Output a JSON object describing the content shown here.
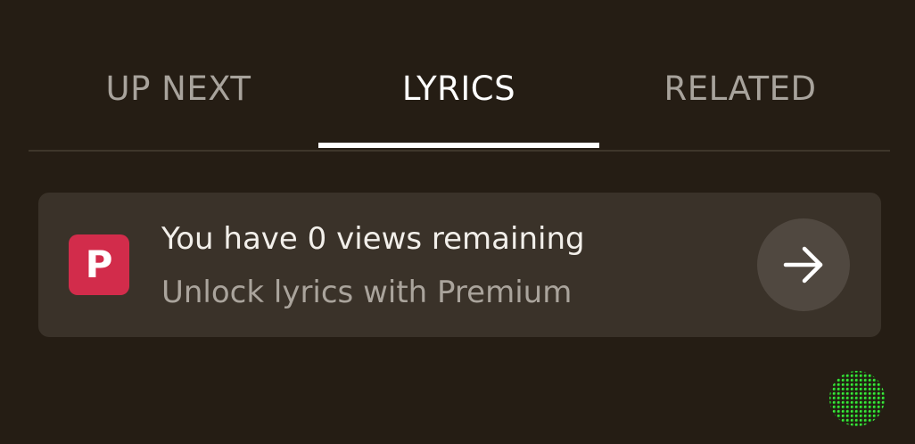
{
  "tabs": [
    {
      "label": "UP NEXT",
      "active": false
    },
    {
      "label": "LYRICS",
      "active": true
    },
    {
      "label": "RELATED",
      "active": false
    }
  ],
  "premium_card": {
    "badge_letter": "P",
    "title": "You have 0 views remaining",
    "subtitle": "Unlock lyrics with Premium",
    "action_icon": "arrow-right-icon"
  },
  "colors": {
    "background": "#251d14",
    "card": "#3a3229",
    "badge": "#d22c4b",
    "active_tab": "#ffffff",
    "inactive_tab": "#a8a39c"
  }
}
